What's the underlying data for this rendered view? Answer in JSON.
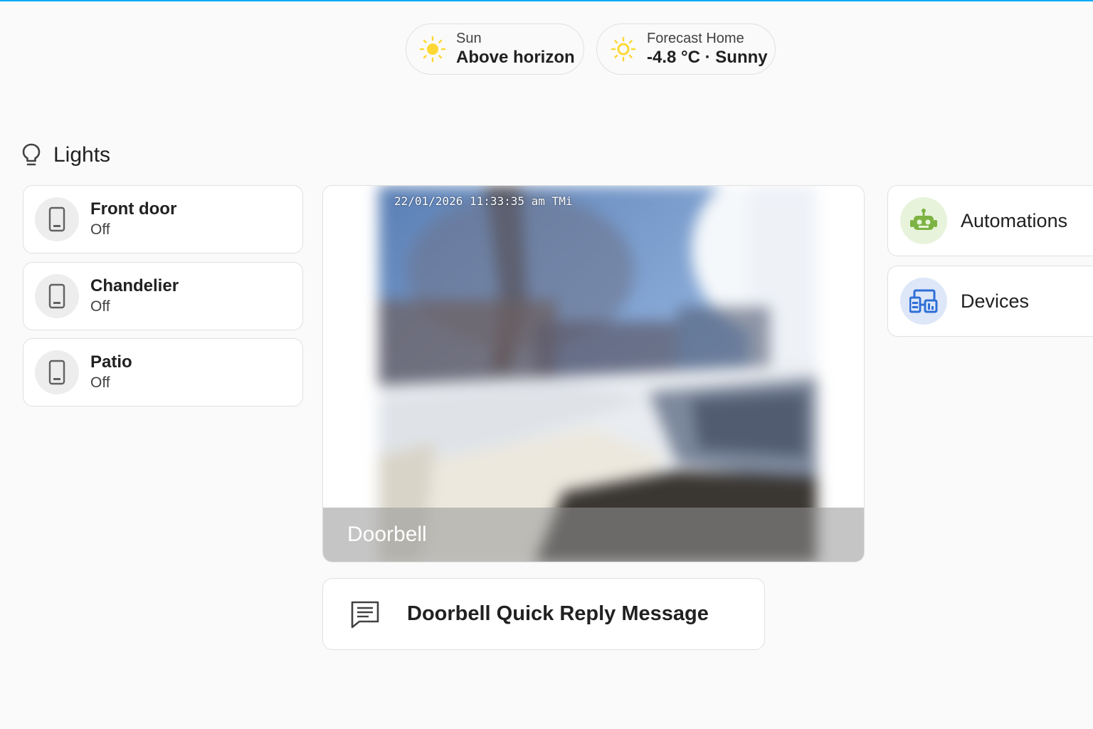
{
  "badges": {
    "sun": {
      "label": "Sun",
      "value": "Above horizon",
      "icon": "sun-icon"
    },
    "forecast": {
      "label": "Forecast Home",
      "value": "-4.8 °C · Sunny",
      "icon": "sunny-weather-icon"
    }
  },
  "lights": {
    "heading": "Lights",
    "icon": "lightbulb-outline-icon",
    "items": [
      {
        "name": "Front door",
        "state": "Off",
        "icon": "light-switch-icon"
      },
      {
        "name": "Chandelier",
        "state": "Off",
        "icon": "light-switch-icon"
      },
      {
        "name": "Patio",
        "state": "Off",
        "icon": "light-switch-icon"
      }
    ]
  },
  "camera": {
    "name": "Doorbell",
    "timestamp": "22/01/2026 11:33:35 am TMi"
  },
  "quick_reply": {
    "label": "Doorbell Quick Reply Message",
    "icon": "message-text-outline-icon"
  },
  "navigation": [
    {
      "label": "Automations",
      "icon": "robot-icon",
      "icon_color": "#7cb342",
      "icon_bg": "#e8f3dc"
    },
    {
      "label": "Devices",
      "icon": "devices-icon",
      "icon_color": "#2f6fd6",
      "icon_bg": "#dde7f8"
    }
  ],
  "colors": {
    "accent": "#03a9f4",
    "sun_yellow": "#fdd835"
  }
}
